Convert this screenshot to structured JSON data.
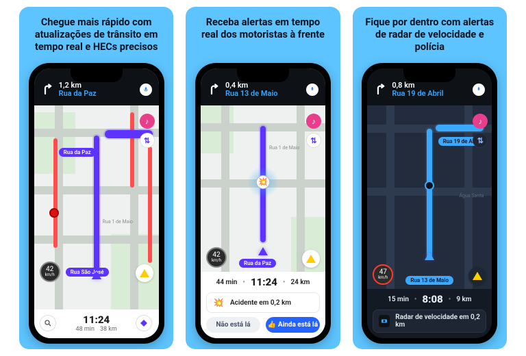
{
  "panels": [
    {
      "headline": "Chegue mais rápido com atualizações de trânsito em tempo real e HECs precisos",
      "nav": {
        "distance": "1,2 km",
        "street": "Rua da Paz"
      },
      "streets": {
        "pill_top": "Rua da Paz",
        "pill_bottom": "Rua São José",
        "label_side": "Rua 1 de Maio"
      },
      "speed": {
        "value": "42",
        "unit": "km/h"
      },
      "bottom": {
        "time": "11:24",
        "eta": "48 min",
        "dist": "38 km"
      }
    },
    {
      "headline": "Receba alertas em tempo real dos motoristas à frente",
      "nav": {
        "distance": "0,4 km",
        "street": "Rua 13 de Maio"
      },
      "streets": {
        "pill_bottom": "Rua da Paz",
        "label_side": "Rua 1 de Maio"
      },
      "speed": {
        "value": "42",
        "unit": "km/h"
      },
      "eta": {
        "min": "44 min",
        "time": "11:24",
        "dist": "24 km"
      },
      "alert": {
        "text": "Acidente em 0,2 km"
      },
      "buttons": {
        "no": "Não está lá",
        "yes": "Ainda está lá"
      }
    },
    {
      "headline": "Fique por dentro com alertas de radar de velocidade e polícia",
      "nav": {
        "distance": "0,8 km",
        "street": "Rua 19 de Abril"
      },
      "streets": {
        "pill_top": "Rua 19 de Abril",
        "pill_bottom": "Rua 13 de Maio",
        "label_side": "Água Santa"
      },
      "speed": {
        "value": "47",
        "unit": "km/h"
      },
      "eta": {
        "min": "15 min",
        "time": "8:08",
        "dist": "9 km"
      },
      "alert": {
        "text": "Radar de velocidade em 0,2 km"
      }
    }
  ],
  "icons": {
    "thumbs": "👍"
  }
}
